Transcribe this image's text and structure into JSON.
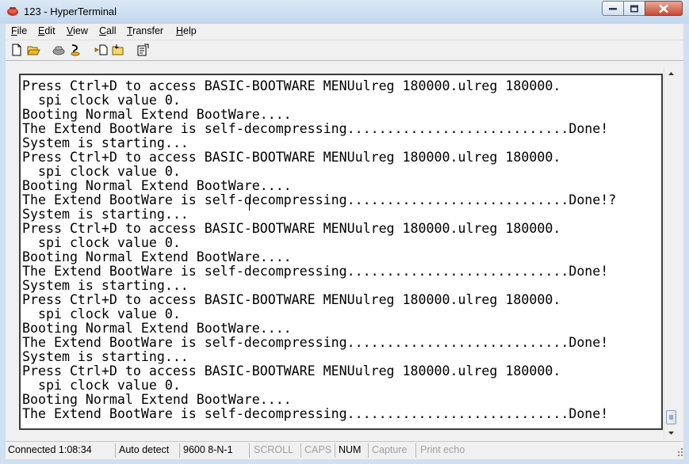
{
  "window": {
    "title": "123 - HyperTerminal",
    "icon": "hyperterminal-phone-icon"
  },
  "menu": [
    {
      "key": "file",
      "accel": "F",
      "rest": "ile"
    },
    {
      "key": "edit",
      "accel": "E",
      "rest": "dit"
    },
    {
      "key": "view",
      "accel": "V",
      "rest": "iew"
    },
    {
      "key": "call",
      "accel": "C",
      "rest": "all"
    },
    {
      "key": "transfer",
      "accel": "T",
      "rest": "ransfer"
    },
    {
      "key": "help",
      "accel": "H",
      "rest": "elp"
    }
  ],
  "toolbar": {
    "icons": [
      "new-icon",
      "open-icon",
      "connect-icon",
      "disconnect-icon",
      "send-icon",
      "receive-icon",
      "properties-icon"
    ]
  },
  "terminal": {
    "lines": [
      "Press Ctrl+D to access BASIC-BOOTWARE MENUulreg 180000.ulreg 180000.",
      "  spi clock value 0.",
      "Booting Normal Extend BootWare....",
      "The Extend BootWare is self-decompressing............................Done!",
      "System is starting...",
      "Press Ctrl+D to access BASIC-BOOTWARE MENUulreg 180000.ulreg 180000.",
      "  spi clock value 0.",
      "Booting Normal Extend BootWare....",
      "The Extend BootWare is self-decompressing............................Done!?",
      "System is starting...",
      "Press Ctrl+D to access BASIC-BOOTWARE MENUulreg 180000.ulreg 180000.",
      "  spi clock value 0.",
      "Booting Normal Extend BootWare....",
      "The Extend BootWare is self-decompressing............................Done!",
      "System is starting...",
      "Press Ctrl+D to access BASIC-BOOTWARE MENUulreg 180000.ulreg 180000.",
      "  spi clock value 0.",
      "Booting Normal Extend BootWare....",
      "The Extend BootWare is self-decompressing............................Done!",
      "System is starting...",
      "Press Ctrl+D to access BASIC-BOOTWARE MENUulreg 180000.ulreg 180000.",
      "  spi clock value 0.",
      "Booting Normal Extend BootWare....",
      "The Extend BootWare is self-decompressing............................Done!"
    ]
  },
  "status": {
    "connected": "Connected 1:08:34",
    "detect": "Auto detect",
    "settings": "9600 8-N-1",
    "scroll": "SCROLL",
    "caps": "CAPS",
    "num": "NUM",
    "capture": "Capture",
    "print_echo": "Print echo"
  },
  "colors": {
    "title_bar": "#c8dbef",
    "close_button": "#c74a34",
    "terminal_bg": "#ffffff",
    "terminal_text": "#000000"
  }
}
